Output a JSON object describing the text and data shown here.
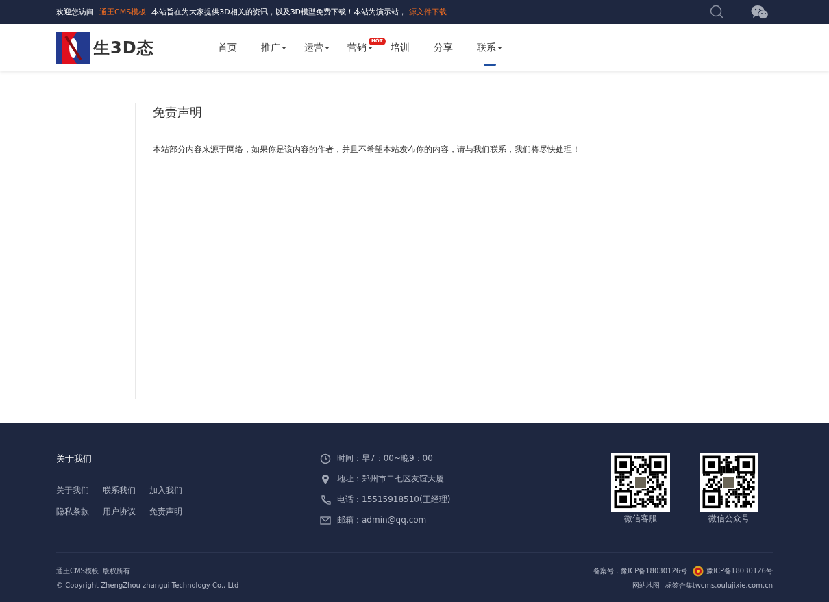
{
  "top_bar": {
    "welcome": "欢迎您访问",
    "site_link": "通王CMS模板",
    "notice": "本站旨在为大家提供3D相关的资讯，以及3D模型免费下载！本站为演示站，",
    "download_link": "源文件下载"
  },
  "logo": {
    "text": "生3D态"
  },
  "nav": [
    {
      "label": "首页",
      "caret": false,
      "selected": false
    },
    {
      "label": "推广",
      "caret": true,
      "selected": false
    },
    {
      "label": "运营",
      "caret": true,
      "selected": false
    },
    {
      "label": "营销",
      "caret": true,
      "selected": false,
      "badge": "HOT"
    },
    {
      "label": "培训",
      "caret": false,
      "selected": false
    },
    {
      "label": "分享",
      "caret": false,
      "selected": false
    },
    {
      "label": "联系",
      "caret": true,
      "selected": true
    }
  ],
  "article": {
    "title": "免责声明",
    "body": "本站部分内容来源于网络，如果你是该内容的作者，并且不希望本站发布你的内容，请与我们联系，我们将尽快处理！"
  },
  "footer": {
    "about_title": "关于我们",
    "links": [
      "关于我们",
      "联系我们",
      "加入我们",
      "隐私条款",
      "用户协议",
      "免责声明"
    ],
    "contacts": [
      {
        "kind": "clock",
        "text": "时间：早7：00~晚9：00"
      },
      {
        "kind": "pin",
        "text": "地址：郑州市二七区友谊大厦"
      },
      {
        "kind": "phone",
        "text": "电话：15515918510(王经理)"
      },
      {
        "kind": "mail",
        "text": "邮箱：admin@qq.com"
      }
    ],
    "qr_codes": [
      {
        "caption": "微信客服"
      },
      {
        "caption": "微信公众号"
      }
    ],
    "copyright": "通王CMS模板  版权所有",
    "copyright_en": "© Copyright ZhengZhou zhangui Technology Co., Ltd",
    "icp": "备案号：豫ICP备18030126号",
    "police_icp": "豫ICP备18030126号",
    "bottom_links": [
      "网站地图",
      "标签合集twcms.oulujixie.com.cn"
    ]
  }
}
